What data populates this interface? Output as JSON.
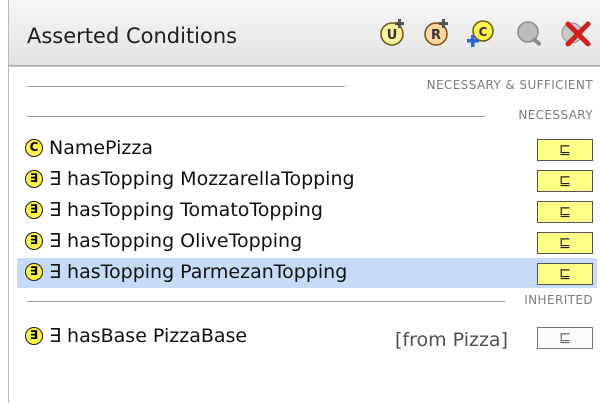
{
  "header": {
    "title": "Asserted Conditions",
    "tools": [
      {
        "icon": "add-restriction-icon",
        "glyph": "U"
      },
      {
        "icon": "add-named-class-icon",
        "glyph": "R"
      },
      {
        "icon": "create-class-icon",
        "glyph": "C"
      },
      {
        "icon": "search-icon",
        "glyph": ""
      },
      {
        "icon": "delete-icon",
        "glyph": ""
      }
    ]
  },
  "sections": {
    "necessary_sufficient": "NECESSARY & SUFFICIENT",
    "necessary": "NECESSARY",
    "inherited": "INHERITED"
  },
  "conditions": [
    {
      "badge": "C",
      "text": "NamePizza",
      "relation": "⊑"
    },
    {
      "badge": "∃",
      "text": "∃ hasTopping MozzarellaTopping",
      "relation": "⊑"
    },
    {
      "badge": "∃",
      "text": "∃ hasTopping TomatoTopping",
      "relation": "⊑"
    },
    {
      "badge": "∃",
      "text": "∃ hasTopping OliveTopping",
      "relation": "⊑"
    },
    {
      "badge": "∃",
      "text": "∃ hasTopping ParmezanTopping",
      "relation": "⊑",
      "selected": true
    }
  ],
  "inherited": [
    {
      "badge": "∃",
      "text": "∃ hasBase PizzaBase",
      "from": "[from Pizza]",
      "relation": "⊑"
    }
  ],
  "colors": {
    "badge_fill": "#fff24d",
    "relation_fill": "#ffff86",
    "selection": "#c5dbf7",
    "delete_red": "#d11f1f"
  }
}
